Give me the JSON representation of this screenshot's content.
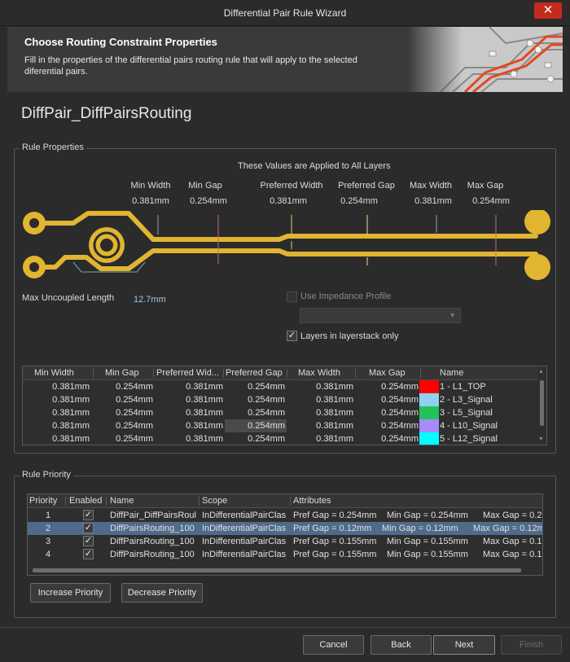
{
  "window": {
    "title": "Differential Pair Rule Wizard",
    "close_glyph": "✕"
  },
  "header": {
    "title": "Choose Routing Constraint Properties",
    "description": "Fill in the properties of the differential pairs routing rule that will apply to the selected diferential pairs."
  },
  "rule_name": "DiffPair_DiffPairsRouting",
  "rule_properties": {
    "group_label": "Rule Properties",
    "applied_note": "These Values are Applied to All Layers",
    "params": [
      {
        "label": "Min Width",
        "value": "0.381mm"
      },
      {
        "label": "Min Gap",
        "value": "0.254mm"
      },
      {
        "label": "Preferred Width",
        "value": "0.381mm"
      },
      {
        "label": "Preferred Gap",
        "value": "0.254mm"
      },
      {
        "label": "Max Width",
        "value": "0.381mm"
      },
      {
        "label": "Max Gap",
        "value": "0.254mm"
      }
    ],
    "max_uncoupled_label": "Max Uncoupled Length",
    "max_uncoupled_value": "12.7mm",
    "use_impedance_label": "Use Impedance Profile",
    "use_impedance_checked": false,
    "layers_only_label": "Layers in layerstack only",
    "layers_only_checked": true,
    "check_glyph": "✓",
    "dropdown_arrow": "▼",
    "trace_color": "#e1b530"
  },
  "layer_table": {
    "columns": [
      "Min Width",
      "Min Gap",
      "Preferred Wid...",
      "Preferred Gap",
      "Max Width",
      "Max Gap",
      "Name"
    ],
    "rows": [
      {
        "min_width": "0.381mm",
        "min_gap": "0.254mm",
        "pref_width": "0.381mm",
        "pref_gap": "0.254mm",
        "max_width": "0.381mm",
        "max_gap": "0.254mm",
        "color": "#ff0000",
        "name": "1 - L1_TOP"
      },
      {
        "min_width": "0.381mm",
        "min_gap": "0.254mm",
        "pref_width": "0.381mm",
        "pref_gap": "0.254mm",
        "max_width": "0.381mm",
        "max_gap": "0.254mm",
        "color": "#8fd1f0",
        "name": "2 - L3_Signal"
      },
      {
        "min_width": "0.381mm",
        "min_gap": "0.254mm",
        "pref_width": "0.381mm",
        "pref_gap": "0.254mm",
        "max_width": "0.381mm",
        "max_gap": "0.254mm",
        "color": "#22c25a",
        "name": "3 - L5_Signal"
      },
      {
        "min_width": "0.381mm",
        "min_gap": "0.254mm",
        "pref_width": "0.381mm",
        "pref_gap": "0.254mm",
        "max_width": "0.381mm",
        "max_gap": "0.254mm",
        "color": "#a78bfa",
        "name": "4 - L10_Signal"
      },
      {
        "min_width": "0.381mm",
        "min_gap": "0.254mm",
        "pref_width": "0.381mm",
        "pref_gap": "0.254mm",
        "max_width": "0.381mm",
        "max_gap": "0.254mm",
        "color": "#00ffff",
        "name": "5 - L12_Signal"
      }
    ]
  },
  "rule_priority": {
    "group_label": "Rule Priority",
    "columns": [
      "Priority",
      "Enabled",
      "Name",
      "Scope",
      "Attributes"
    ],
    "rows": [
      {
        "priority": "1",
        "enabled": true,
        "name": "DiffPair_DiffPairsRoul",
        "scope": "InDifferentialPairClas",
        "pref_gap": "Pref Gap = 0.254mm",
        "min_gap": "Min Gap  = 0.254mm",
        "max_gap": "Max Gap  = 0.2"
      },
      {
        "priority": "2",
        "enabled": true,
        "name": "DiffPairsRouting_100",
        "scope": "InDifferentialPairClas",
        "pref_gap": "Pref Gap = 0.12mm",
        "min_gap": "Min Gap  = 0.12mm",
        "max_gap": "Max Gap  = 0.12m"
      },
      {
        "priority": "3",
        "enabled": true,
        "name": "DiffPairsRouting_100",
        "scope": "InDifferentialPairClas",
        "pref_gap": "Pref Gap = 0.155mm",
        "min_gap": "Min Gap  = 0.155mm",
        "max_gap": "Max Gap  = 0.1"
      },
      {
        "priority": "4",
        "enabled": true,
        "name": "DiffPairsRouting_100",
        "scope": "InDifferentialPairClas",
        "pref_gap": "Pref Gap = 0.155mm",
        "min_gap": "Min Gap  = 0.155mm",
        "max_gap": "Max Gap  = 0.1"
      }
    ],
    "selected_row": "2",
    "increase_label": "Increase Priority",
    "decrease_label": "Decrease Priority"
  },
  "footer": {
    "cancel": "Cancel",
    "back": "Back",
    "next": "Next",
    "finish": "Finish"
  }
}
